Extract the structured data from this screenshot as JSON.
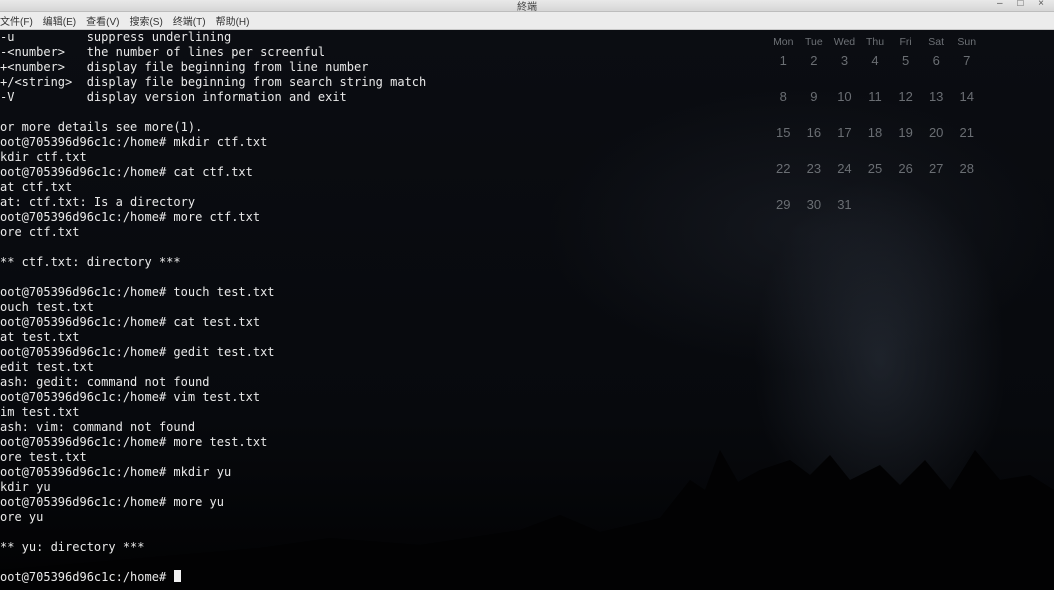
{
  "window": {
    "title": "終端",
    "controls": "– □ ×"
  },
  "menu": [
    "文件(F)",
    "编辑(E)",
    "查看(V)",
    "搜索(S)",
    "终端(T)",
    "帮助(H)"
  ],
  "terminal": {
    "lines": [
      "-u          suppress underlining",
      "-<number>   the number of lines per screenful",
      "+<number>   display file beginning from line number",
      "+/<string>  display file beginning from search string match",
      "-V          display version information and exit",
      "",
      "or more details see more(1).",
      "oot@705396d96c1c:/home# mkdir ctf.txt",
      "kdir ctf.txt",
      "oot@705396d96c1c:/home# cat ctf.txt",
      "at ctf.txt",
      "at: ctf.txt: Is a directory",
      "oot@705396d96c1c:/home# more ctf.txt",
      "ore ctf.txt",
      "",
      "** ctf.txt: directory ***",
      "",
      "oot@705396d96c1c:/home# touch test.txt",
      "ouch test.txt",
      "oot@705396d96c1c:/home# cat test.txt",
      "at test.txt",
      "oot@705396d96c1c:/home# gedit test.txt",
      "edit test.txt",
      "ash: gedit: command not found",
      "oot@705396d96c1c:/home# vim test.txt",
      "im test.txt",
      "ash: vim: command not found",
      "oot@705396d96c1c:/home# more test.txt",
      "ore test.txt",
      "oot@705396d96c1c:/home# mkdir yu",
      "kdir yu",
      "oot@705396d96c1c:/home# more yu",
      "ore yu",
      "",
      "** yu: directory ***",
      "",
      "oot@705396d96c1c:/home# "
    ]
  },
  "calendar": {
    "weekdays": [
      "Mon",
      "Tue",
      "Wed",
      "Thu",
      "Fri",
      "Sat",
      "Sun"
    ],
    "weeks": [
      [
        "1",
        "2",
        "3",
        "4",
        "5",
        "6",
        "7"
      ],
      [
        "8",
        "9",
        "10",
        "11",
        "12",
        "13",
        "14"
      ],
      [
        "15",
        "16",
        "17",
        "18",
        "19",
        "20",
        "21"
      ],
      [
        "22",
        "23",
        "24",
        "25",
        "26",
        "27",
        "28"
      ],
      [
        "29",
        "30",
        "31",
        "",
        "",
        "",
        ""
      ]
    ]
  }
}
